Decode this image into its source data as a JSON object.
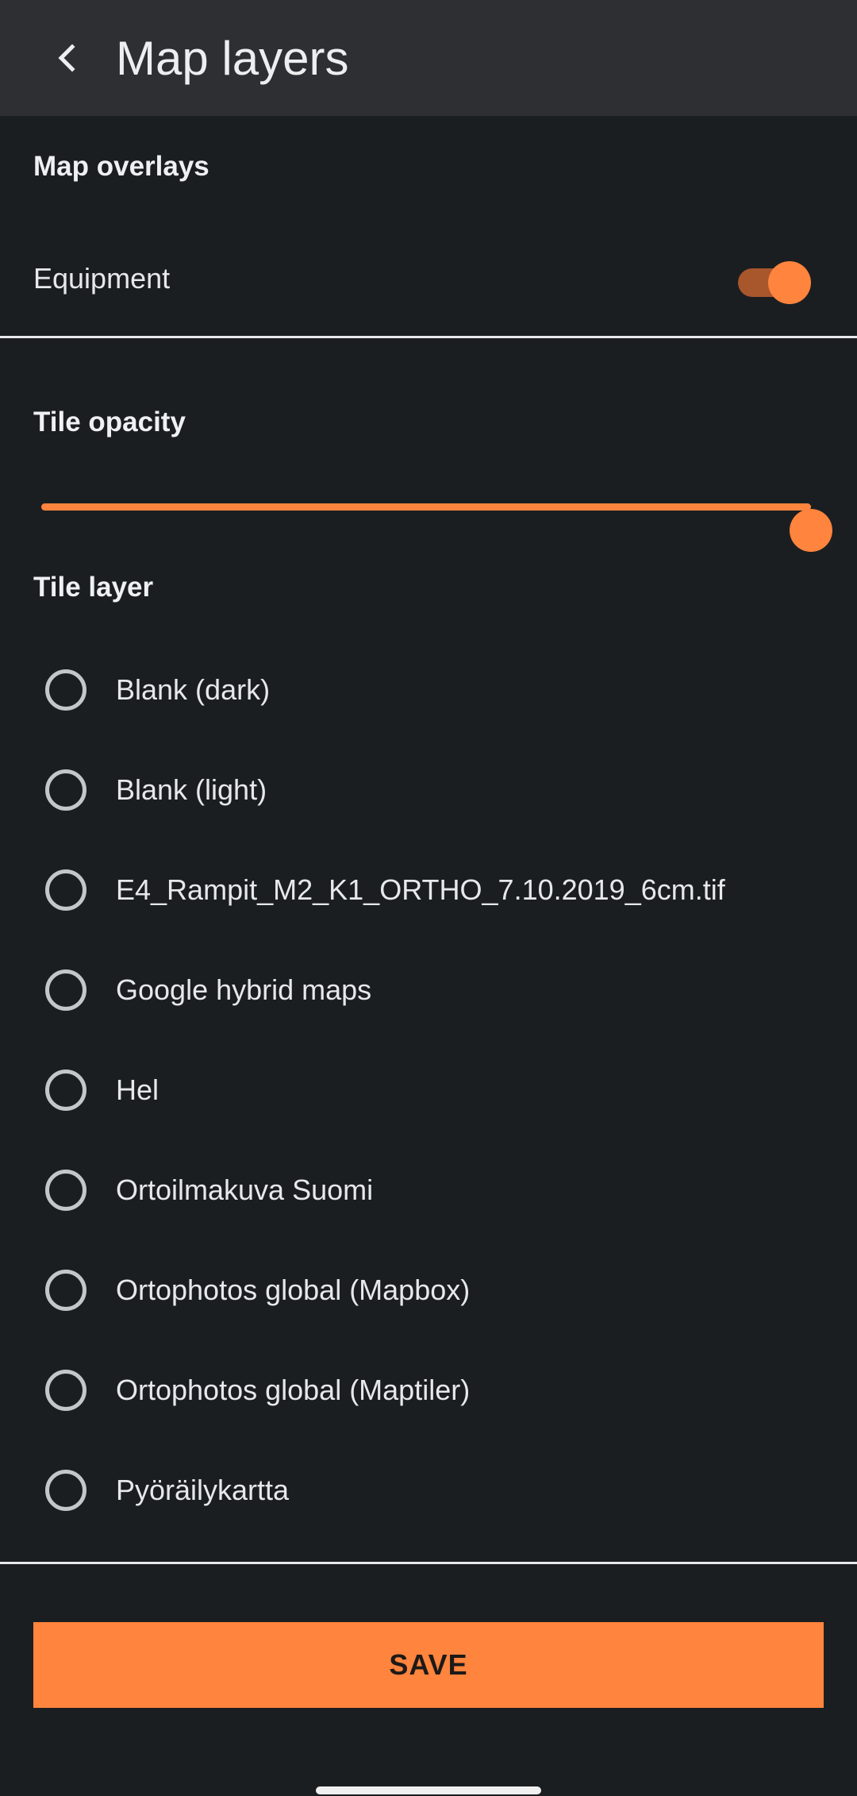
{
  "app_bar": {
    "back_icon": "chevron-left-icon",
    "title": "Map layers"
  },
  "overlays": {
    "heading": "Map overlays",
    "items": [
      {
        "label": "Equipment",
        "enabled": true
      }
    ]
  },
  "opacity": {
    "heading": "Tile opacity",
    "value": 1.0
  },
  "tile_layer": {
    "heading": "Tile layer",
    "options": [
      {
        "label": "Blank (dark)",
        "selected": false
      },
      {
        "label": "Blank (light)",
        "selected": false
      },
      {
        "label": "E4_Rampit_M2_K1_ORTHO_7.10.2019_6cm.tif",
        "selected": false
      },
      {
        "label": "Google hybrid maps",
        "selected": false
      },
      {
        "label": "Hel",
        "selected": false
      },
      {
        "label": "Ortoilmakuva Suomi",
        "selected": false
      },
      {
        "label": "Ortophotos global (Mapbox)",
        "selected": false
      },
      {
        "label": "Ortophotos global (Maptiler)",
        "selected": false
      },
      {
        "label": "Pyöräilykartta",
        "selected": false
      }
    ]
  },
  "actions": {
    "save_label": "SAVE"
  },
  "colors": {
    "accent": "#ff843d",
    "background": "#1b1e21",
    "app_bar": "#2d2f32"
  }
}
